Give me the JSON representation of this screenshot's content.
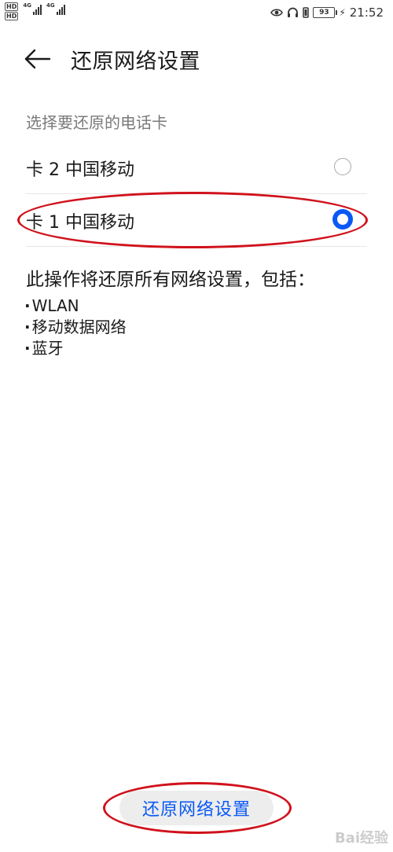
{
  "status_bar": {
    "hd1": "HD",
    "hd2": "HD",
    "net1": "4G",
    "net2": "4G",
    "battery": "93",
    "time": "21:52"
  },
  "header": {
    "title": "还原网络设置"
  },
  "section_label": "选择要还原的电话卡",
  "sim_options": [
    {
      "label": "卡 2 中国移动",
      "selected": false
    },
    {
      "label": "卡 1 中国移动",
      "selected": true
    }
  ],
  "description": "此操作将还原所有网络设置，包括：",
  "items": [
    "WLAN",
    "移动数据网络",
    "蓝牙"
  ],
  "reset_button_label": "还原网络设置",
  "watermark": "Bai经验",
  "colors": {
    "accent": "#0a59f7",
    "annotation": "#d0121b"
  }
}
